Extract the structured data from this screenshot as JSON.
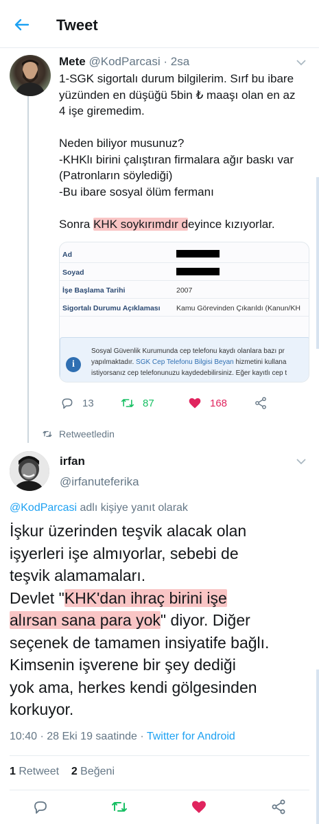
{
  "header": {
    "title": "Tweet"
  },
  "colors": {
    "accent": "#1da1f2",
    "like": "#e0245e",
    "retweet": "#17bf63",
    "muted": "#657786",
    "highlight": "#f49696"
  },
  "tweet1": {
    "name": "Mete",
    "handle": "@KodParcasi",
    "time": "· 2sa",
    "lines": [
      "1-SGK sigortalı durum bilgilerim. Sırf bu ibare",
      "yüzünden en düşüğü 5bin ₺ maaşı olan en az",
      "4 işe giremedim.",
      "",
      "Neden biliyor musunuz?",
      "-KHKlı birini çalıştıran firmalara ağır baskı var",
      "(Patronların söylediği)",
      "-Bu ibare sosyal ölüm fermanı",
      ""
    ],
    "last_line": {
      "before": "Sonra ",
      "highlight": "KHK soykırımdır d",
      "after": "eyince kızıyorlar."
    },
    "card": {
      "rows": [
        {
          "label": "Ad",
          "value": ""
        },
        {
          "label": "Soyad",
          "value": ""
        },
        {
          "label": "İşe Başlama Tarihi",
          "value": "2007"
        },
        {
          "label": "Sigortalı Durumu Açıklaması",
          "value": "Kamu Görevinden Çıkarıldı (Kanun/KH"
        }
      ],
      "info_icon": "i",
      "info_line1": "Sosyal Güvenlik Kurumunda cep telefonu kaydı olanlara bazı pr",
      "info_line2_pre": "yapılmaktadır. ",
      "info_line2_link": "SGK Cep Telefonu Bilgisi Beyan",
      "info_line2_post": " hizmetini kullana",
      "info_line3": "istiyorsanız cep telefonunuzu kaydedebilirsiniz. Eğer kayıtlı cep t"
    },
    "actions": {
      "replies": "13",
      "retweets": "87",
      "likes": "168"
    }
  },
  "retweeted_label": "Retweetledin",
  "tweet2": {
    "name": "irfan",
    "handle": "@irfanuteferika",
    "reply_mention": "@KodParcasi",
    "reply_suffix": " adlı kişiye yanıt olarak",
    "body_lines_1": [
      "İşkur üzerinden teşvik alacak olan",
      "işyerleri işe almıyorlar, sebebi de",
      "teşvik alamamaları."
    ],
    "body_line4_pre": "Devlet  \"",
    "body_line4_hl": "KHK'dan ihraç birini işe",
    "body_line5_hl": "alırsan sana para yok",
    "body_line5_post": "\" diyor. Diğer",
    "body_lines_2": [
      "seçenek de tamamen insiyatife bağlı.",
      "Kimsenin işverene bir şey dediği",
      "yok ama, herkes kendi gölgesinden",
      "korkuyor."
    ],
    "time": "10:40 · 28 Eki 19 saatinde · ",
    "source": "Twitter for Android",
    "retweet_count": "1",
    "retweet_label": " Retweet",
    "like_count": "2",
    "like_label": " Beğeni"
  },
  "icons": [
    "back-arrow-icon",
    "caret-down-icon",
    "reply-icon",
    "retweet-icon",
    "heart-icon",
    "share-icon"
  ]
}
